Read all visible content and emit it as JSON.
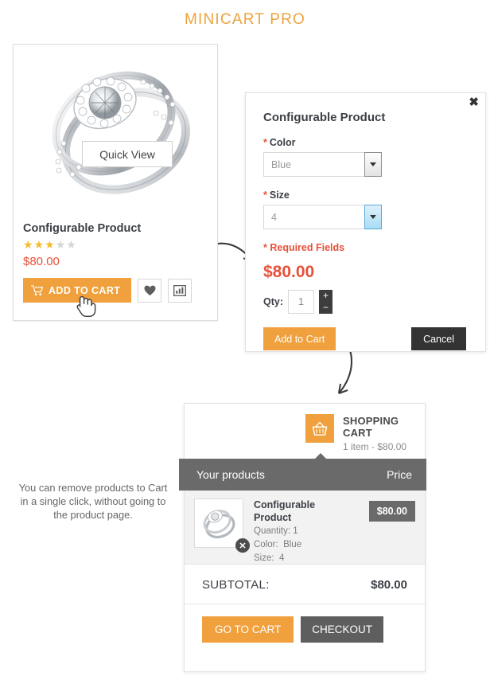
{
  "page": {
    "title": "MINICART PRO",
    "accent_orange": "#f0a03c",
    "price_red": "#e8513a",
    "grey_dark": "#6a6a6a"
  },
  "product_card": {
    "quick_view_label": "Quick View",
    "name": "Configurable Product",
    "rating_filled": 3,
    "rating_total": 5,
    "price": "$80.00",
    "add_to_cart_label": "ADD TO CART",
    "wishlist_icon": "heart-icon",
    "compare_icon": "compare-bars-icon",
    "cart_icon": "shopping-cart-icon",
    "product_image_alt": "diamond-ring-image"
  },
  "quick_view_popup": {
    "close_label": "✖",
    "title": "Configurable Product",
    "required_marker": "*",
    "options": [
      {
        "label": "Color",
        "value": "Blue",
        "required": true,
        "state": "normal"
      },
      {
        "label": "Size",
        "value": "4",
        "required": true,
        "state": "hover"
      }
    ],
    "required_fields_note": "* Required Fields",
    "price": "$80.00",
    "qty_label": "Qty:",
    "qty_value": "1",
    "qty_plus": "+",
    "qty_minus": "−",
    "add_to_cart_label": "Add to Cart",
    "cancel_label": "Cancel"
  },
  "caption": {
    "text": "You can remove products to Cart in a single click, without going to the product page."
  },
  "minicart": {
    "basket_icon": "shopping-basket-icon",
    "title": "SHOPPING CART",
    "summary": "1 item - $80.00",
    "columns": {
      "products": "Your products",
      "price": "Price"
    },
    "items": [
      {
        "name": "Configurable Product",
        "quantity_label": "Quantity:",
        "quantity_value": "1",
        "color_label": "Color:",
        "color_value": "Blue",
        "size_label": "Size:",
        "size_value": "4",
        "price": "$80.00",
        "remove_icon": "close-x-icon",
        "thumbnail_alt": "diamond-ring-thumbnail"
      }
    ],
    "subtotal_label": "SUBTOTAL:",
    "subtotal_value": "$80.00",
    "go_to_cart_label": "GO TO CART",
    "checkout_label": "CHECKOUT"
  }
}
